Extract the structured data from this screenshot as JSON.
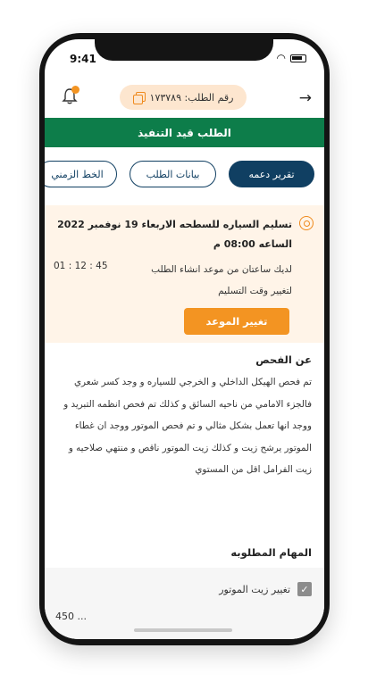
{
  "status_bar": {
    "time": "9:41"
  },
  "header": {
    "order_label": "رقم الطلب: ١٧٣٧٨٩"
  },
  "order_status": "الطلب قيد التنفيذ",
  "tabs": [
    {
      "label": "تقرير دعمه"
    },
    {
      "label": "بيانات الطلب"
    },
    {
      "label": "الخط الزمني"
    }
  ],
  "delivery": {
    "title": "تسليم السياره للسطحه الاربعاء 19 نوفمبر 2022 الساعه 08:00 م",
    "remaining_text": "لديك ساعتان من موعد انشاء الطلب",
    "change_hint": "لتغيير وقت التسليم",
    "countdown": "01 : 12 : 45",
    "change_button": "تغيير الموعد"
  },
  "inspection": {
    "title": "عن الفحص",
    "body": "تم فحص الهيكل الداخلي و الخرجي للسياره و وجد كسر شعري فالجزء الامامي من ناحيه السائق و كذلك تم فحص انظمه التبريد و ووجد انها تعمل بشكل مثالي و تم فحص الموتور ووجد ان غطاء الموتور يرشح زيت و كذلك زيت الموتور ناقص و منتهي صلاحيه و زيت الفرامل اقل من المستوي"
  },
  "tasks": {
    "title": "المهام المطلوبه",
    "items": [
      {
        "label": "تغيير زيت الموتور",
        "checked": true
      }
    ],
    "price_partial": "450 ..."
  },
  "colors": {
    "green": "#0d7d4a",
    "navy": "#103f62",
    "orange": "#f39422",
    "cream": "#fff4e8"
  }
}
